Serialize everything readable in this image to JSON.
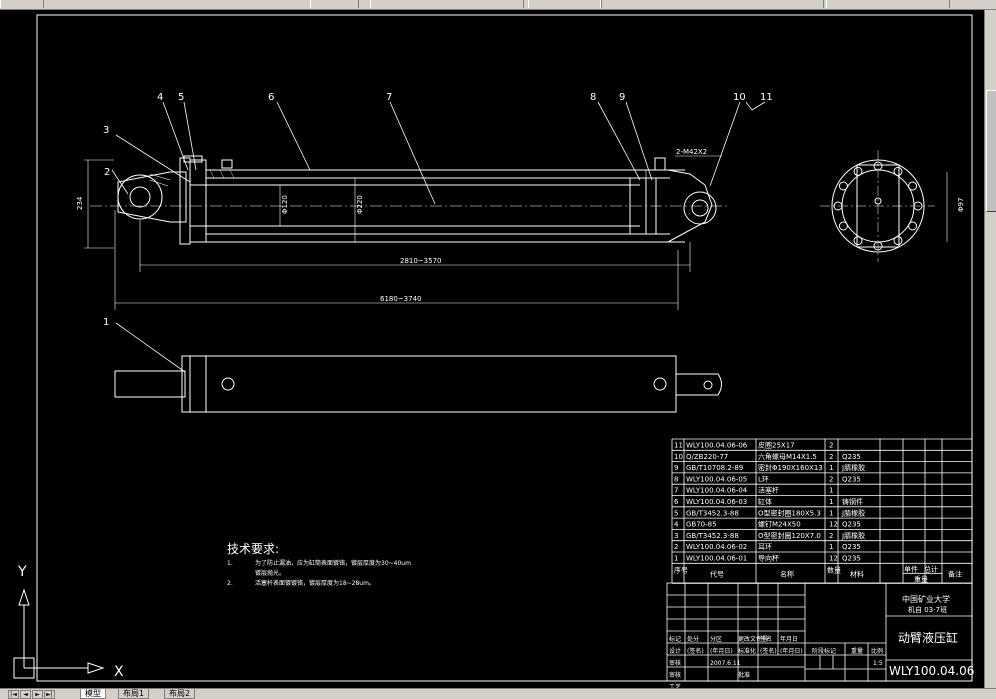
{
  "window": {
    "toolbar_items": [
      "",
      "",
      "",
      "",
      "",
      ""
    ]
  },
  "drawing": {
    "callouts": [
      "1",
      "2",
      "3",
      "4",
      "5",
      "6",
      "7",
      "8",
      "9",
      "10",
      "11"
    ],
    "dimensions": {
      "bore": "Φ220",
      "rod": "Φ120",
      "height": "234",
      "stroke": "2810~3570",
      "overall": "6180~3740",
      "thread": "2-M42X2",
      "flange": "Φ97"
    },
    "tech_req": {
      "title": "技术要求:",
      "lines": [
        {
          "num": "1.",
          "text": "为了防止漏油，应为缸筒表面镀铬，镀层厚度为30~40um"
        },
        {
          "num": "",
          "text": "镀层抛光。"
        },
        {
          "num": "2.",
          "text": "活塞杆表面镀镀铬，镀层厚度为18~28um。"
        }
      ]
    },
    "bom": {
      "rows": [
        {
          "no": "11",
          "code": "WLY100.04.06-06",
          "name": "皮圈25X17",
          "qty": "2",
          "material": "",
          "note": ""
        },
        {
          "no": "10",
          "code": "Q/ZB220-77",
          "name": "六角螺母M14X1.5",
          "qty": "2",
          "material": "Q235",
          "note": ""
        },
        {
          "no": "9",
          "code": "GB/T10708.2-89",
          "name": "密封Φ190X160X13",
          "qty": "1",
          "material": "J腈橡胶",
          "note": ""
        },
        {
          "no": "8",
          "code": "WLY100.04.06-05",
          "name": "L环",
          "qty": "2",
          "material": "Q235",
          "note": ""
        },
        {
          "no": "7",
          "code": "WLY100.04.06-04",
          "name": "活塞杆",
          "qty": "1",
          "material": "",
          "note": ""
        },
        {
          "no": "6",
          "code": "WLY100.04.06-03",
          "name": "缸体",
          "qty": "1",
          "material": "铸钢件",
          "note": ""
        },
        {
          "no": "5",
          "code": "GB/T3452.3-88",
          "name": "O型密封圈180X5.3",
          "qty": "1",
          "material": "J腈橡胶",
          "note": ""
        },
        {
          "no": "4",
          "code": "GB70-85",
          "name": "螺钉M24X50",
          "qty": "12",
          "material": "Q235",
          "note": ""
        },
        {
          "no": "3",
          "code": "GB/T3452.3-88",
          "name": "O型密封圈120X7.0",
          "qty": "2",
          "material": "J腈橡胶",
          "note": ""
        },
        {
          "no": "2",
          "code": "WLY100.04.06-02",
          "name": "耳环",
          "qty": "1",
          "material": "Q235",
          "note": ""
        },
        {
          "no": "1",
          "code": "WLY100.04.06-01",
          "name": "导向杯",
          "qty": "12",
          "material": "Q235",
          "note": ""
        }
      ],
      "header": {
        "no": "序号",
        "code": "代号",
        "name": "名称",
        "qty": "数量",
        "material": "材料",
        "unit_single": "单件",
        "unit_total": "总计",
        "weight": "重量",
        "note": "备注"
      }
    },
    "title_block": {
      "school": "中国矿业大学",
      "class": "机自 03-7班",
      "part_name": "动臂液压缸",
      "drawing_no": "WLY100.04.06",
      "labels": {
        "mark": "标记",
        "count": "处分",
        "zone": "分区",
        "change_doc": "更改文件号",
        "sign": "签名",
        "date": "年月日",
        "design": "设计",
        "standard": "标准化",
        "review": "审核",
        "craft": "工艺",
        "approve": "批准",
        "stage": "阶段标记",
        "weight": "重量",
        "scale": "比例"
      },
      "values": {
        "sign1": "(签名)",
        "date1": "(年月日)",
        "date2": "2007.6.11",
        "scale": "1:5"
      }
    },
    "ucs": {
      "x": "X",
      "y": "Y"
    }
  },
  "tabs": {
    "model": "模型",
    "layout1": "布局1",
    "layout2": "布局2"
  }
}
